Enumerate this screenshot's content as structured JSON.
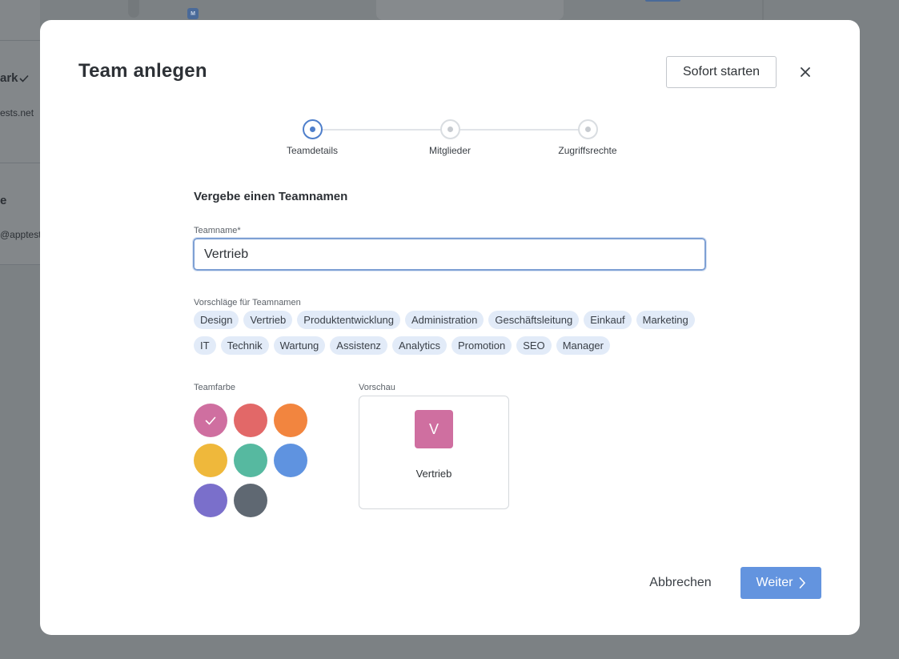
{
  "background": {
    "partial_texts": [
      "ark",
      "ests.net",
      "e",
      "@apptest"
    ],
    "badge_letter": "M"
  },
  "modal": {
    "title": "Team anlegen",
    "start_button_label": "Sofort starten",
    "close_icon": "close-icon"
  },
  "stepper": {
    "steps": [
      {
        "label": "Teamdetails",
        "state": "active"
      },
      {
        "label": "Mitglieder",
        "state": "pending"
      },
      {
        "label": "Zugriffsrechte",
        "state": "pending"
      }
    ]
  },
  "form": {
    "section_title": "Vergebe einen Teamnamen",
    "team_name_label": "Teamname*",
    "team_name_value": "Vertrieb",
    "suggestions_label": "Vorschläge für Teamnamen",
    "suggestions": [
      "Design",
      "Vertrieb",
      "Produktentwicklung",
      "Administration",
      "Geschäftsleitung",
      "Einkauf",
      "Marketing",
      "IT",
      "Technik",
      "Wartung",
      "Assistenz",
      "Analytics",
      "Promotion",
      "SEO",
      "Manager"
    ]
  },
  "colors": {
    "label": "Teamfarbe",
    "swatches": [
      "#cf6fa0",
      "#e26868",
      "#f2853f",
      "#efb83b",
      "#56b9a0",
      "#5f93e0",
      "#7a6fcb",
      "#5f6872"
    ],
    "selected_index": 0
  },
  "preview": {
    "label": "Vorschau",
    "initial": "V",
    "name": "Vertrieb",
    "color": "#cf6fa0"
  },
  "footer": {
    "cancel_label": "Abbrechen",
    "next_label": "Weiter",
    "next_icon": "chevron-right-icon"
  }
}
